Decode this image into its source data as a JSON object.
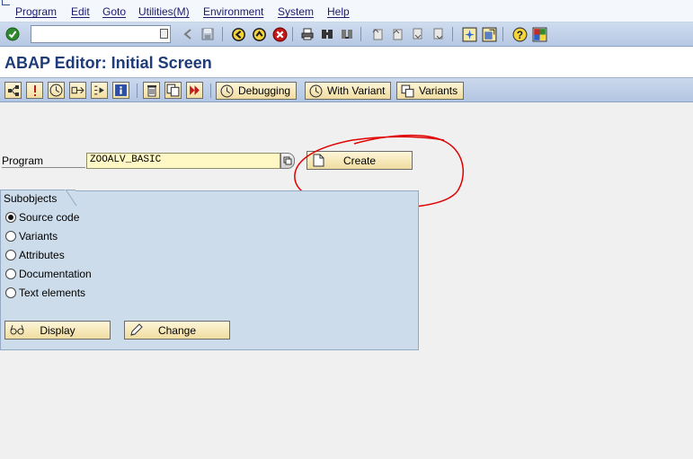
{
  "menu": {
    "items": [
      "Program",
      "Edit",
      "Goto",
      "Utilities(M)",
      "Environment",
      "System",
      "Help"
    ]
  },
  "system_toolbar": {
    "command_field": {
      "value": "",
      "placeholder": ""
    },
    "icons": [
      "enter-icon",
      "back-icon",
      "save-icon",
      "back-green-icon",
      "exit-icon",
      "cancel-icon",
      "print-icon",
      "find-icon",
      "find-next-icon",
      "first-page-icon",
      "previous-page-icon",
      "next-page-icon",
      "last-page-icon",
      "create-session-icon",
      "shortcut-icon",
      "help-icon",
      "customize-layout-icon"
    ]
  },
  "title": "ABAP Editor: Initial Screen",
  "app_toolbar": {
    "icons": [
      "object-list-icon",
      "where-used-icon",
      "test-icon",
      "check-icon",
      "activate-icon",
      "info-icon",
      "delete-icon",
      "copy-icon",
      "rename-icon"
    ],
    "buttons": {
      "debugging": "Debugging",
      "with_variant": "With Variant",
      "variants": "Variants"
    }
  },
  "form": {
    "program_label": "Program",
    "program_value": "ZOOALV_BASIC",
    "create_label": "Create"
  },
  "subobjects": {
    "title": "Subobjects",
    "options": [
      {
        "label": "Source code",
        "selected": true
      },
      {
        "label": "Variants",
        "selected": false
      },
      {
        "label": "Attributes",
        "selected": false
      },
      {
        "label": "Documentation",
        "selected": false
      },
      {
        "label": "Text elements",
        "selected": false
      }
    ],
    "display_label": "Display",
    "change_label": "Change"
  },
  "colors": {
    "title": "#1f3c7a",
    "toolbar": "#c2d3ea",
    "group_box": "#cddcea",
    "input_required": "#fff7c4",
    "annotation": "#e00000"
  }
}
